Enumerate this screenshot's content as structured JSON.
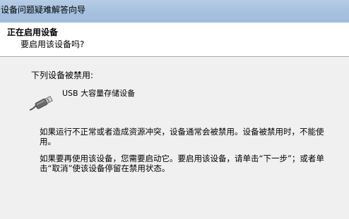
{
  "window": {
    "title": "设备问题疑难解答向导"
  },
  "header": {
    "heading": "正在启用设备",
    "subheading": "要启用该设备吗?"
  },
  "body": {
    "list_label": "下列设备被禁用:",
    "device": {
      "name": "USB 大容量存储设备",
      "icon": "usb-plug-icon"
    },
    "paragraph_1": "如果运行不正常或者造成资源冲突，设备通常会被禁用。设备被禁用时，不能使用。",
    "paragraph_2": "如果要再使用该设备，您需要启动它。要启用该设备，请单击“下一步”；或者单击“取消”使该设备停留在禁用状态。"
  },
  "colors": {
    "titlebar": "#a9c3e0",
    "header_bg": "#ffffff",
    "body_bg": "#f0f0f0"
  }
}
